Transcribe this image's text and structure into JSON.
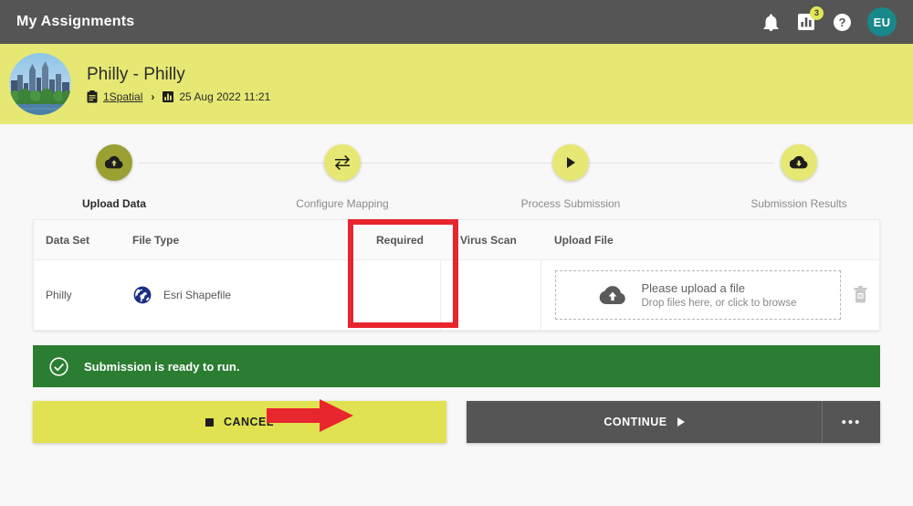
{
  "topbar": {
    "title": "My Assignments",
    "icons": [
      {
        "name": "notifications-bell-icon",
        "label": ""
      },
      {
        "name": "reports-chart-icon",
        "label": "",
        "badge": "3"
      },
      {
        "name": "help-question-icon",
        "label": ""
      }
    ],
    "notification_badge": "3",
    "avatar_initials": "EU"
  },
  "banner": {
    "title": "Philly - Philly",
    "breadcrumb_org": "1Spatial",
    "breadcrumb_separator": "›",
    "breadcrumb_date": "25 Aug 2022 11:21",
    "org_icon": "clipboard-icon",
    "date_icon": "bar-chart-icon",
    "photo_alt": "philadelphia-skyline-avatar",
    "background_color": "#e6e873"
  },
  "stepper": {
    "steps": [
      {
        "label": "Upload Data",
        "icon": "cloud-upload-icon",
        "active": true
      },
      {
        "label": "Configure Mapping",
        "icon": "swap-arrows-icon",
        "active": false
      },
      {
        "label": "Process Submission",
        "icon": "play-triangle-icon",
        "active": false
      },
      {
        "label": "Submission Results",
        "icon": "cloud-download-icon",
        "active": false
      }
    ],
    "active_color": "#9ba033",
    "inactive_color": "#e6e873"
  },
  "table": {
    "headers": {
      "data_set": "Data Set",
      "file_type": "File Type",
      "required": "Required",
      "virus_scan": "Virus Scan",
      "upload_file": "Upload File"
    },
    "rows": [
      {
        "data_set": "Philly",
        "file_type": "Esri Shapefile",
        "file_type_icon": "globe-icon",
        "required": "",
        "virus_scan": "",
        "upload_main": "Please upload a file",
        "upload_sub": "Drop files here, or click to browse",
        "upload_icon": "cloud-upload-icon",
        "delete_icon": "trash-delete-icon"
      }
    ]
  },
  "status": {
    "message": "Submission is ready to run.",
    "icon": "check-circle-icon",
    "color": "#2b7d32"
  },
  "actions": {
    "cancel_label": "CANCEL",
    "cancel_icon": "stop-square-icon",
    "continue_label": "CONTINUE",
    "continue_icon": "play-triangle-icon",
    "more_label": "•••"
  },
  "annotations": {
    "highlight_color": "#e8262d",
    "box_target": "virus-scan-column",
    "arrow_target": "virus-scan-column"
  }
}
